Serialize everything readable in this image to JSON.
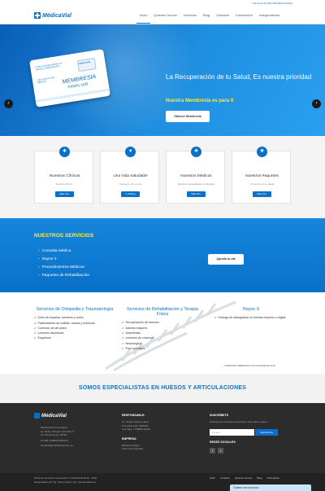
{
  "topbar": {
    "phone": "Llámenos! 01 800 300 MEDICO(633)"
  },
  "brand": {
    "name": "MédicaVial"
  },
  "nav": [
    "Inicio",
    "Quienes Somos",
    "Servicios",
    "Blog",
    "Contacto",
    "Facturación",
    "Aseguradoras"
  ],
  "hero": {
    "title": "La Recuperación de tu Salud, Es nuestra prioridad",
    "subtitle": "Nuestra Membresía es para ti",
    "cta": "Obtener Membresía",
    "card": {
      "line1": "Centro de Especialistas en Huesos y Articulaciones",
      "chip": "Médica Vial",
      "phone": "Call Center 01 800 MEDICO",
      "m1": "MEMBRESIA",
      "m2": "FAMILIAR"
    },
    "prev": "‹",
    "next": "›"
  },
  "features": [
    {
      "title": "Nuestras Clínicas",
      "desc": "Servicio 24 Hrs.",
      "button": "Más Info.",
      "icon": "clinic-icon",
      "glyph": "✚"
    },
    {
      "title": "Una Vida Saludable",
      "desc": "Consejos, tips y más",
      "button": "Ir al Blog",
      "icon": "heart-icon",
      "glyph": "♥"
    },
    {
      "title": "Nuestros Médicos",
      "desc": "Médicos especialistas certificados",
      "button": "Más Info.",
      "icon": "stethoscope-icon",
      "glyph": "✚"
    },
    {
      "title": "Nuestros Paquetes",
      "desc": "Al servicio de tu salud",
      "button": "Más Info.",
      "icon": "medkit-icon",
      "glyph": "✚"
    }
  ],
  "services": {
    "title": "NUESTROS SERVICIOS",
    "items": [
      "Consulta Médica",
      "Rayos X",
      "Procedimientos Médicos",
      "Paquetes de Rehabilitación"
    ],
    "cta": "Agenda tu cita"
  },
  "specialties": [
    {
      "title": "Servicios de Ortopedia y Traumatología",
      "items": [
        "Dolor de espalda, hombros y cuello",
        "Padecimiento de rodillas, manos y muñecas",
        "Corrector de pie plano",
        "Lesiones deportivas",
        "Esguinces"
      ]
    },
    {
      "title": "Servicios de Rehabilitación y Terapia Física",
      "items": [
        "Recuperación de lesiones",
        "Adultos mayores",
        "Deportistas",
        "Lesiones de columna",
        "Neurológica",
        "Post quirúrgica"
      ]
    },
    {
      "title": "Rayos X",
      "items": [
        "Entrega de radiografías en formato impreso o digital"
      ]
    }
  ],
  "specialties_note": "*ATENCIÓN INMEDIATA POR UN ESPECIALISTA",
  "tagline": "SOMOS ESPECIALISTAS EN HUESOS Y ARTICULACIONES",
  "footer": {
    "brand": "MédicaVial",
    "address": [
      "MédicaVial (Corporativo)",
      "av. Álvaro Obregón 151 Piso 9",
      "Col. Roma Norte, 06700"
    ],
    "phone": "01 800 3 MEDICO(633 4)",
    "email": "contacto@medicavial.com.mx",
    "responsable_title": "RESPONSABLE:",
    "responsable": [
      "Dr. Sergio Oceano Hérra",
      "D.N.I.M.E Ced. 5461352",
      "Ced. Esp. 1738660 Adj.38"
    ],
    "empresa_title": "EMPRESA",
    "empresa": [
      "Bolsa de trabajo",
      "Aviso de privacidad"
    ],
    "subscribe_title": "SUSCRÍBETE",
    "subscribe_text": "Entérate de nuestras promociones sólo para tu salud",
    "email_placeholder": "Correo",
    "subscribe_button": "Suscribirme",
    "social_title": "REDES SOCIALES",
    "social": [
      "f",
      "t"
    ]
  },
  "bottom": {
    "copyright": "Todos los derechos reservados © MédicaVial 2016 - 2018",
    "credit": "Desarrollado por Ing. Sergio Alvéz | Ing. Samuel Ramírez",
    "links": [
      "Inicio",
      "Contacto",
      "Quienes Somos",
      "Blog",
      "Facturación"
    ]
  },
  "chat": {
    "label": "Chatea con nosotros"
  }
}
